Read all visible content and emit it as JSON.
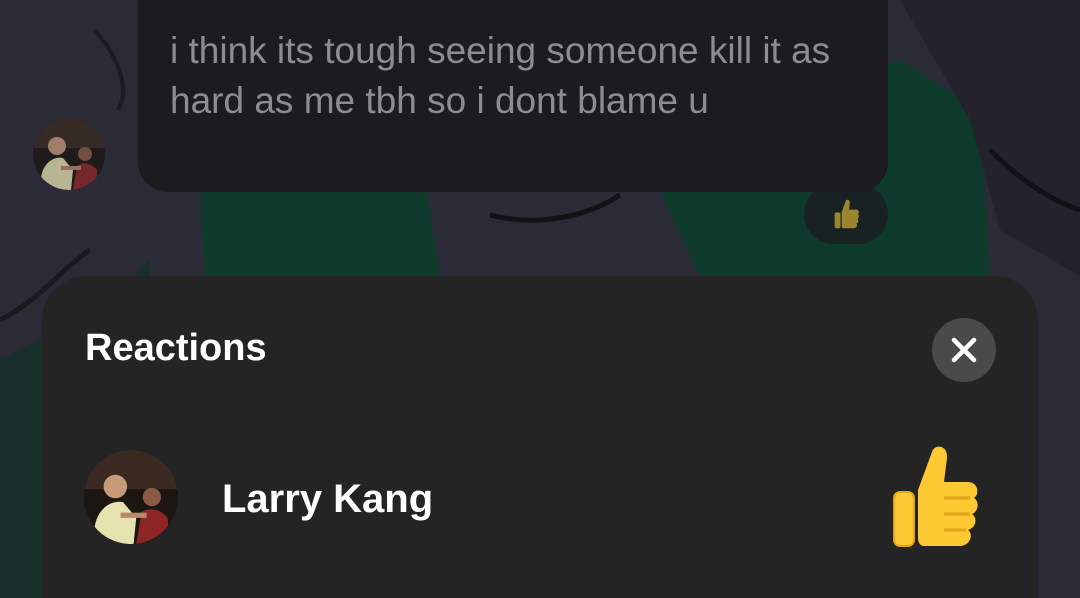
{
  "message": {
    "text": "i think its tough seeing someone kill it as hard as me tbh so i dont blame u",
    "reaction_icon": "thumbs-up-icon",
    "sender_avatar": "avatar-photo"
  },
  "sheet": {
    "title": "Reactions",
    "close_icon": "close-icon",
    "reactions": [
      {
        "name": "Larry Kang",
        "emoji": "thumbs-up-icon"
      }
    ]
  },
  "colors": {
    "sheet_background": "#242424",
    "bubble_background": "#1c1b20",
    "close_button": "#4a4a4b",
    "thumb_yellow": "#fdc933"
  }
}
